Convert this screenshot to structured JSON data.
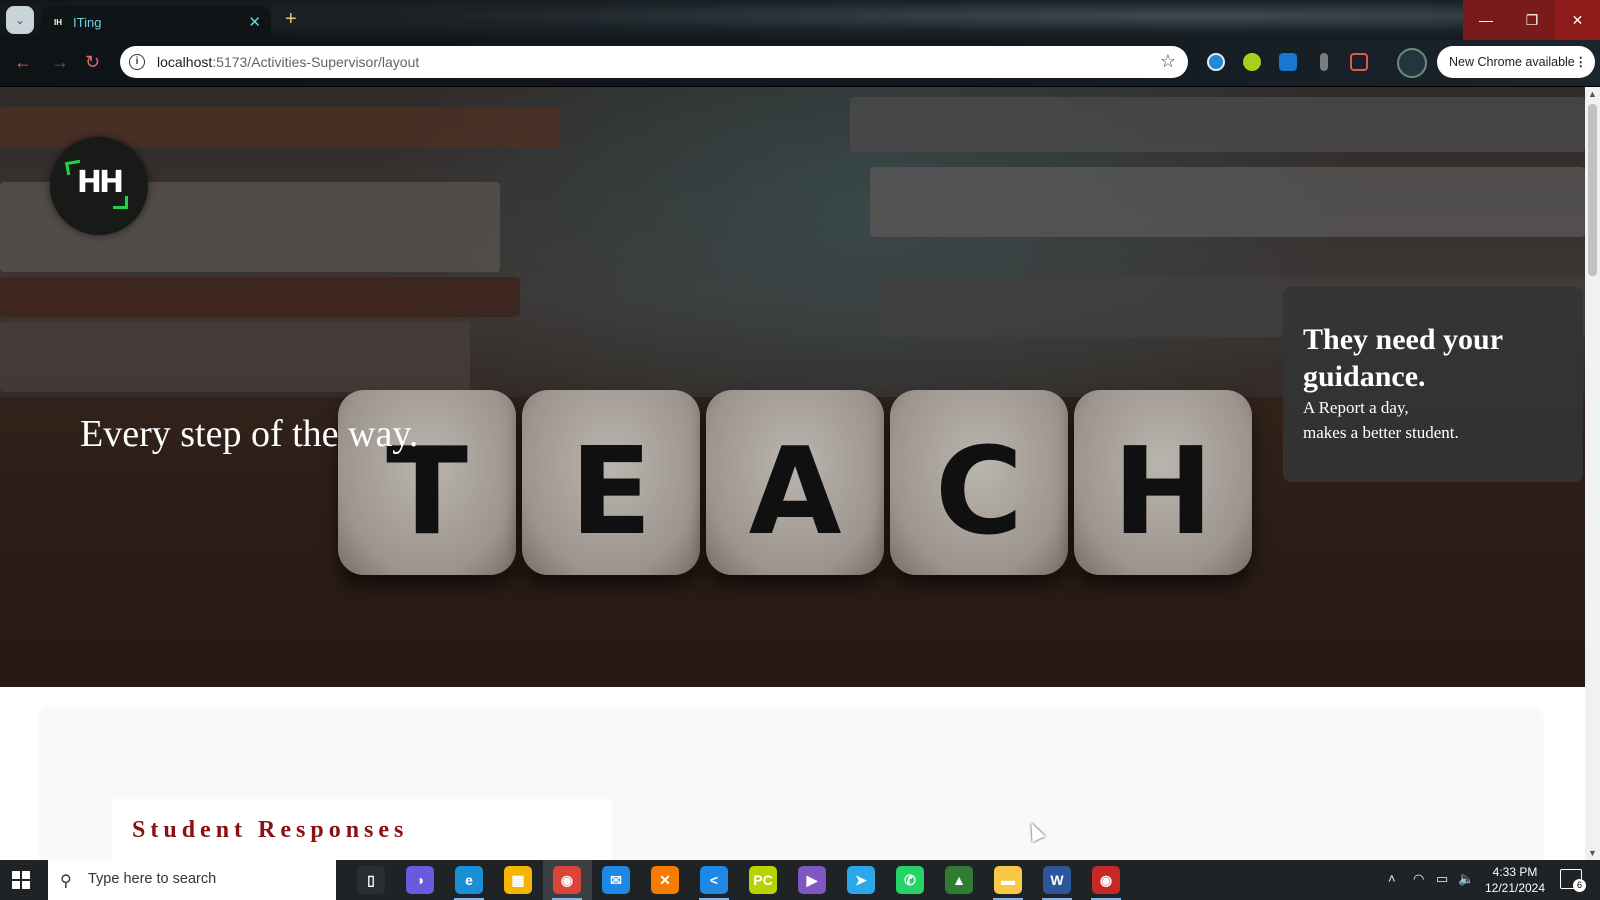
{
  "browser": {
    "tab_title": "ITing",
    "tab_favicon_text": "IH",
    "new_tab_symbol": "+",
    "url_host": "localhost",
    "url_path": ":5173/Activities-Supervisor/layout",
    "update_label": "New Chrome available",
    "window_controls": {
      "minimize": "—",
      "maximize": "❐",
      "close": "✕"
    }
  },
  "hero": {
    "logo_text": "HH",
    "dice_letters": [
      "T",
      "E",
      "A",
      "C",
      "H"
    ],
    "tagline": "Every step of the way.",
    "card": {
      "title": "They need your guidance.",
      "line1": "A Report a day,",
      "line2": "makes a better student."
    }
  },
  "content": {
    "section_title": "Student Responses"
  },
  "taskbar": {
    "search_placeholder": "Type here to search",
    "time": "4:33 PM",
    "date": "12/21/2024",
    "notification_count": "6",
    "apps": [
      {
        "name": "task-view",
        "color": "#2b2f33",
        "glyph": "▯"
      },
      {
        "name": "copilot",
        "color": "#6b5ae0",
        "glyph": "◑"
      },
      {
        "name": "edge",
        "color": "#1b8fd6",
        "glyph": "e"
      },
      {
        "name": "store",
        "color": "#f4b400",
        "glyph": "▦"
      },
      {
        "name": "chrome",
        "color": "#db4437",
        "glyph": "◉"
      },
      {
        "name": "mail",
        "color": "#1e88e5",
        "glyph": "✉"
      },
      {
        "name": "xampp",
        "color": "#f57c00",
        "glyph": "✕"
      },
      {
        "name": "vscode",
        "color": "#1e88e5",
        "glyph": "<"
      },
      {
        "name": "pycharm",
        "color": "#b8d400",
        "glyph": "PC"
      },
      {
        "name": "vs-purple",
        "color": "#7e57c2",
        "glyph": "▶"
      },
      {
        "name": "telegram",
        "color": "#29a9eb",
        "glyph": "➤"
      },
      {
        "name": "whatsapp",
        "color": "#25d366",
        "glyph": "✆"
      },
      {
        "name": "anydesk-green",
        "color": "#2e7d32",
        "glyph": "▲"
      },
      {
        "name": "file-explorer",
        "color": "#f9c844",
        "glyph": "▬"
      },
      {
        "name": "word",
        "color": "#2b579a",
        "glyph": "W"
      },
      {
        "name": "chrome-profile",
        "color": "#c62828",
        "glyph": "◉"
      }
    ]
  }
}
